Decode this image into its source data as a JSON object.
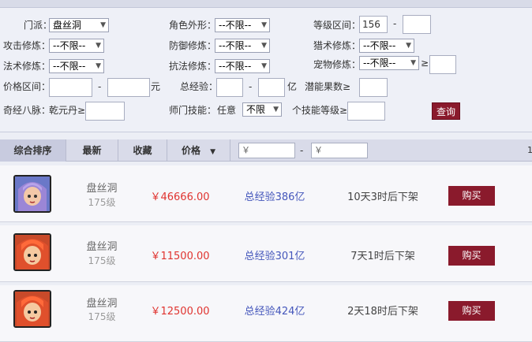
{
  "filters": {
    "school_label": "门派：",
    "school_value": "盘丝洞",
    "appearance_label": "角色外形：",
    "appearance_value": "--不限--",
    "level_label": "等级区间：",
    "level_min": "156",
    "level_dash": "-",
    "level_max": "",
    "atk_label": "攻击修炼：",
    "atk_value": "--不限--",
    "def_label": "防御修炼：",
    "def_value": "--不限--",
    "hunt_label": "猎术修炼：",
    "hunt_value": "--不限--",
    "magic_label": "法术修炼：",
    "magic_value": "--不限--",
    "resist_label": "抗法修炼：",
    "resist_value": "--不限--",
    "pet_label": "宠物修炼：",
    "pet_value": "--不限--",
    "pet_ge": "≥",
    "price_label": "价格区间：",
    "price_dash": "-",
    "price_unit": "元",
    "exp_label": "总经验：",
    "exp_dash": "-",
    "exp_unit": "亿",
    "potential_label": "潜能果数≥",
    "meridian_label": "奇经八脉：",
    "meridian_item": "乾元丹≥",
    "skill_label": "师门技能：",
    "skill_any": "任意",
    "skill_value": "不限",
    "skill_level_label": "个技能等级≥",
    "query_button": "查询"
  },
  "sortbar": {
    "tabs": [
      "综合排序",
      "最新",
      "收藏",
      "价格"
    ],
    "price_from": "￥",
    "price_dash": "-",
    "price_to": "￥",
    "page_hint": "1"
  },
  "listings": [
    {
      "school": "盘丝洞",
      "level": "175级",
      "price": "￥46666.00",
      "exp": "总经验386亿",
      "time": "10天3时后下架",
      "buy": "购买"
    },
    {
      "school": "盘丝洞",
      "level": "175级",
      "price": "￥11500.00",
      "exp": "总经验301亿",
      "time": "7天1时后下架",
      "buy": "购买"
    },
    {
      "school": "盘丝洞",
      "level": "175级",
      "price": "￥12500.00",
      "exp": "总经验424亿",
      "time": "2天18时后下架",
      "buy": "购买"
    }
  ],
  "colors": {
    "accent": "#8a1a2c",
    "price": "#e0332f",
    "exp": "#4456bb"
  }
}
